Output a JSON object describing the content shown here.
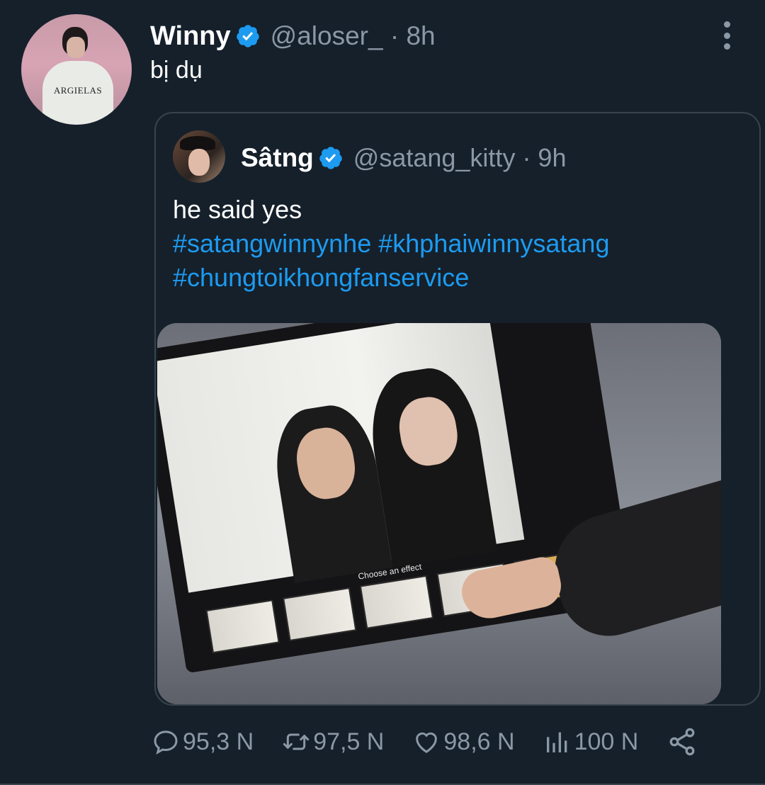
{
  "tweet": {
    "author_name": "Winny",
    "handle_time": "@aloser_ · 8h",
    "text": "bị dụ",
    "avatar_shirt_text": "ARGIELAS"
  },
  "quoted": {
    "author_name": "Sâtng",
    "handle_time": "@satang_kitty · 9h",
    "text": "he said yes",
    "hashtags": [
      "#satangwinnynhe",
      "#khphaiwinnysatang",
      "#chungtoikhongfanservice"
    ],
    "media_caption": "Choose an effect"
  },
  "actions": {
    "replies": "95,3 N",
    "retweets": "97,5 N",
    "likes": "98,6 N",
    "views": "100 N"
  },
  "colors": {
    "background": "#15202b",
    "accent": "#1d9bf0",
    "secondary_text": "#8b98a5",
    "border": "#38444d"
  },
  "icons": [
    "verified-badge-icon",
    "more-icon",
    "reply-icon",
    "retweet-icon",
    "like-icon",
    "views-icon",
    "share-icon"
  ]
}
